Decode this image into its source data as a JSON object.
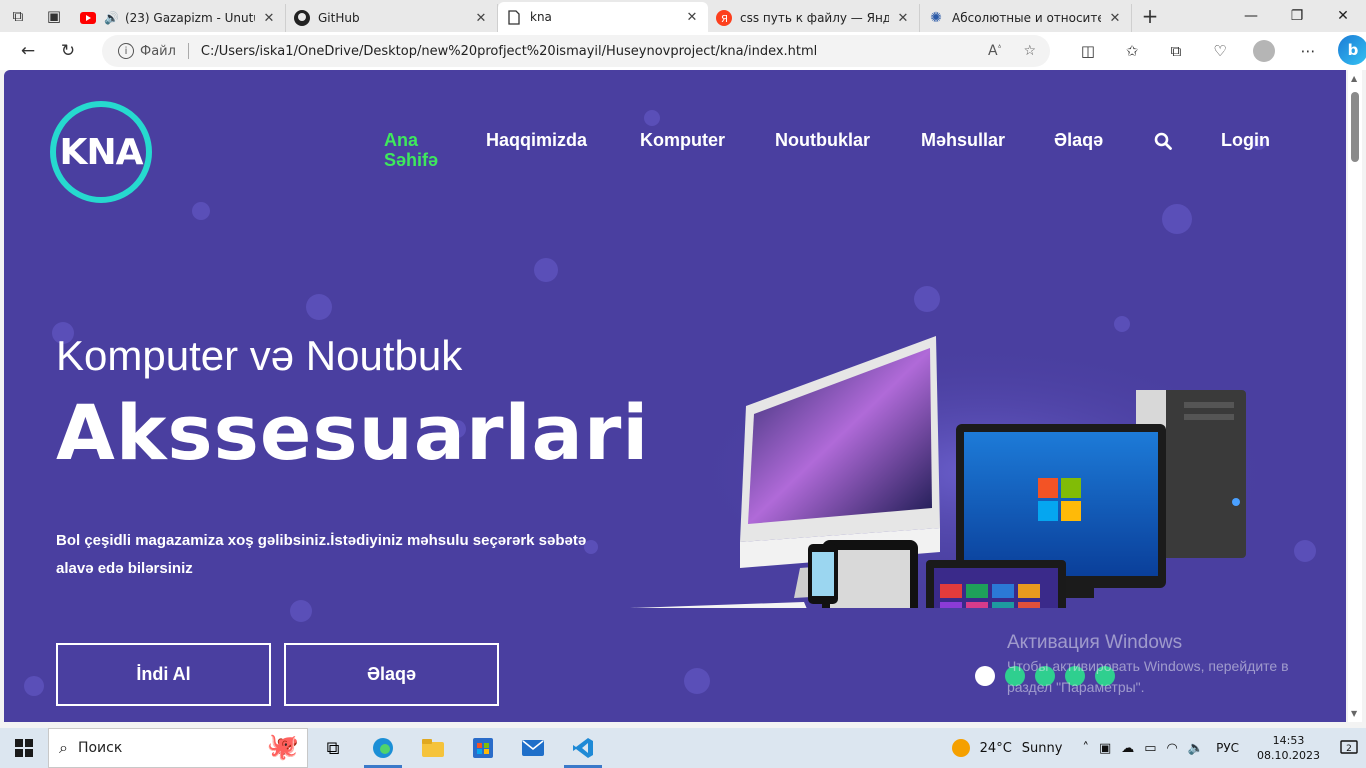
{
  "browser": {
    "tabs": [
      {
        "title": "(23) Gazapizm - Unutul",
        "favicon": "youtube-icon",
        "active": false
      },
      {
        "title": "GitHub",
        "favicon": "github-icon",
        "active": false
      },
      {
        "title": "kna",
        "favicon": "file-icon",
        "active": true
      },
      {
        "title": "css путь к файлу — Яндекс",
        "favicon": "yandex-icon",
        "active": false
      },
      {
        "title": "Абсолютные и относитель",
        "favicon": "gear-icon",
        "active": false
      }
    ],
    "address": {
      "scheme_label": "Файл",
      "url": "C:/Users/iska1/OneDrive/Desktop/new%20profject%20ismayil/Huseynovproject/kna/index.html"
    }
  },
  "site": {
    "logo_text": "KNA",
    "nav": [
      {
        "label": "Ana Səhifə",
        "active": true
      },
      {
        "label": "Haqqimizda",
        "active": false
      },
      {
        "label": "Komputer",
        "active": false
      },
      {
        "label": "Noutbuklar",
        "active": false
      },
      {
        "label": "Məhsullar",
        "active": false
      },
      {
        "label": "Əlaqə",
        "active": false
      }
    ],
    "login_label": "Login",
    "hero": {
      "subtitle": "Komputer və Noutbuk",
      "title": "Akssesuarlari",
      "text": "Bol çeşidli magazamiza xoş gəlibsiniz.İstədiyiniz məhsulu seçərərk səbətə alavə edə bilərsiniz",
      "primary_button": "İndi Al",
      "secondary_button": "Əlaqə"
    },
    "slider": {
      "total": 5,
      "active_index": 0
    }
  },
  "windows_activation": {
    "title": "Активация Windows",
    "text": "Чтобы активировать Windows, перейдите в раздел \"Параметры\"."
  },
  "taskbar": {
    "search_placeholder": "Поиск",
    "weather": {
      "temp": "24°C",
      "condition": "Sunny"
    },
    "language": "РУС",
    "time": "14:53",
    "date": "08.10.2023",
    "notification_count": "2"
  },
  "colors": {
    "hero_bg": "#4a3fa0",
    "logo_ring": "#26d9cf",
    "nav_active": "#3ee85c",
    "slider_dot": "#2fcf8f"
  }
}
